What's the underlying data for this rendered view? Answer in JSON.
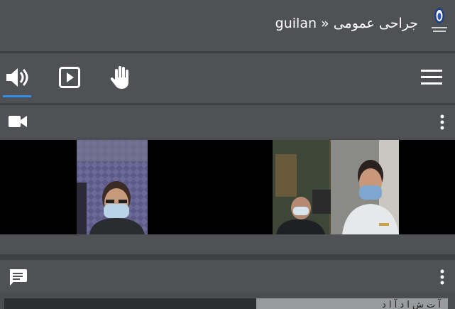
{
  "header": {
    "title": "guilan » جراحی عمومی"
  },
  "toolbar": {
    "items": [
      {
        "icon": "speaker-icon",
        "active": true
      },
      {
        "icon": "play-icon",
        "active": false
      },
      {
        "icon": "raise-hand-icon",
        "active": false
      },
      {
        "icon": "hamburger-menu-icon",
        "active": false
      }
    ]
  },
  "video_panel": {
    "icon": "video-camera-icon",
    "participants": [
      {
        "name": ""
      },
      {
        "name": ""
      }
    ]
  },
  "chat_panel": {
    "icon": "chat-icon",
    "partial_text": "آ ت ش ا د آ ا د"
  },
  "colors": {
    "accent": "#2f8fe8",
    "bar_bg": "#4f5154",
    "divider": "#3d3f42"
  }
}
